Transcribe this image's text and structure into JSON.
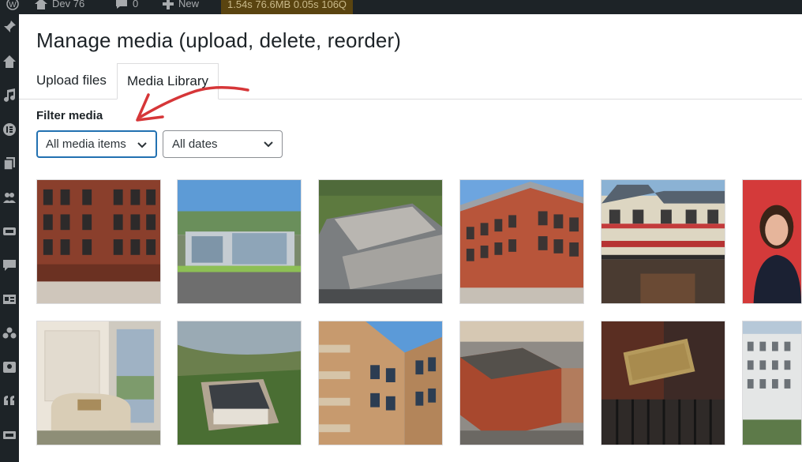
{
  "adminbar": {
    "site_name": "Dev 76",
    "comments_count": "0",
    "new_label": "New",
    "perf": "1.54s  76.6MB  0.05s  106Q"
  },
  "modal": {
    "title": "Manage media (upload, delete, reorder)",
    "tabs": [
      {
        "label": "Upload files",
        "active": false
      },
      {
        "label": "Media Library",
        "active": true
      }
    ],
    "filter_label": "Filter media",
    "type_filter": {
      "value": "All media items"
    },
    "date_filter": {
      "value": "All dates"
    }
  },
  "media_items": [
    {
      "subject": "brick-apartment-facade"
    },
    {
      "subject": "glass-office-park-aerial"
    },
    {
      "subject": "industrial-warehouse-aerial"
    },
    {
      "subject": "corner-brick-building"
    },
    {
      "subject": "hotel-with-flowers"
    },
    {
      "subject": "woman-portrait-red"
    },
    {
      "subject": "interior-armchair-window"
    },
    {
      "subject": "coastal-house-aerial"
    },
    {
      "subject": "balcony-apartment-block"
    },
    {
      "subject": "city-block-aerial"
    },
    {
      "subject": "brass-sign-gate"
    },
    {
      "subject": "white-apartment-block"
    }
  ],
  "colors": {
    "admin_bg": "#1d2327",
    "accent": "#2271b1",
    "annotation": "#d63638"
  }
}
